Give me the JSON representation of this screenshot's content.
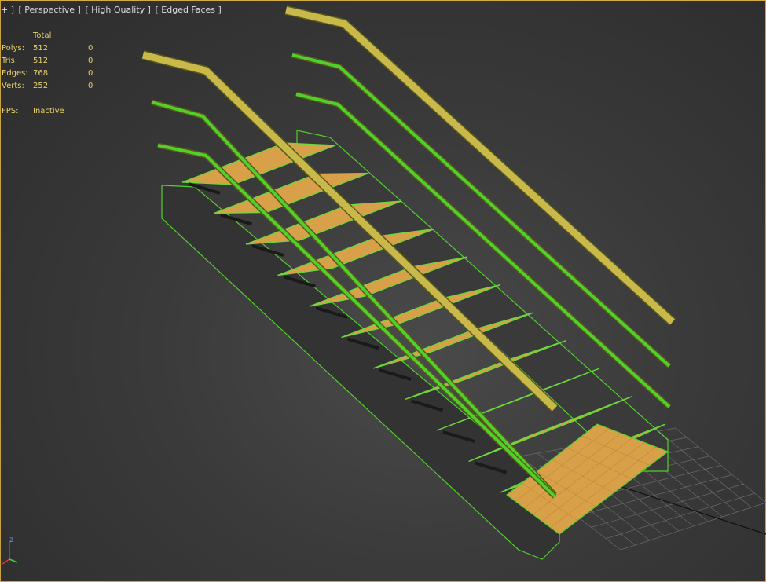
{
  "viewport": {
    "menu": {
      "plus": "+ ]",
      "view": "[ Perspective ]",
      "quality": "[ High Quality ]",
      "shading": "[ Edged Faces ]"
    },
    "stats": {
      "total_header": "Total",
      "rows": [
        {
          "label": "Polys:",
          "total": "512",
          "selected": "0"
        },
        {
          "label": "Tris:",
          "total": "512",
          "selected": "0"
        },
        {
          "label": "Edges:",
          "total": "768",
          "selected": "0"
        },
        {
          "label": "Verts:",
          "total": "252",
          "selected": "0"
        }
      ],
      "fps_label": "FPS:",
      "fps_value": "Inactive"
    },
    "axis_gizmo": {
      "z_label": "z"
    }
  },
  "colors": {
    "frame": "#c8a23a",
    "stats_text": "#e8d06a",
    "tread": "#d9a04a",
    "tread_edge": "#6ad83a",
    "stringer": "#2a2a2a",
    "handrail": "#c9b84a",
    "wire": "#4fd02a",
    "grid": "#6a6a6a"
  }
}
